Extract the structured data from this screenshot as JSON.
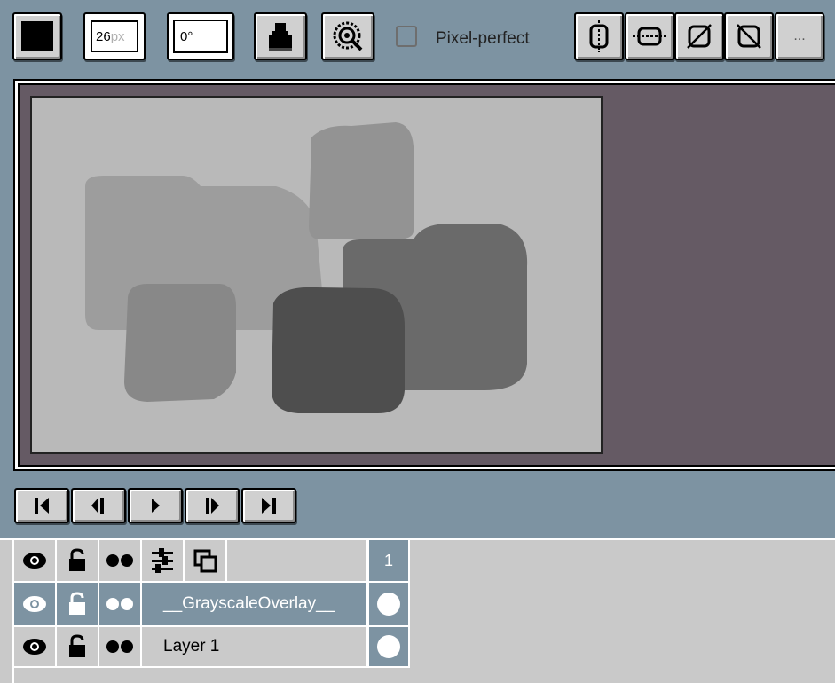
{
  "toolbar": {
    "color_swatch": "#000000",
    "brush_size_value": "26",
    "brush_size_unit": "px",
    "angle_value": "0°",
    "pixel_perfect_label": "Pixel-perfect",
    "pixel_perfect_checked": false,
    "symmetry_icons": [
      "symmetry-vertical-icon",
      "symmetry-horizontal-icon",
      "symmetry-diagonal-icon",
      "symmetry-antidiagonal-icon"
    ],
    "more_label": "..."
  },
  "canvas": {
    "background": "#655a64",
    "sprite_background": "#b9b9b9"
  },
  "playback": {
    "buttons": [
      "first-frame",
      "previous-frame",
      "play",
      "next-frame",
      "last-frame"
    ]
  },
  "timeline": {
    "frame_number": "1",
    "layers": [
      {
        "name": "__GrayscaleOverlay__",
        "selected": true
      },
      {
        "name": "Layer 1",
        "selected": false
      }
    ]
  }
}
